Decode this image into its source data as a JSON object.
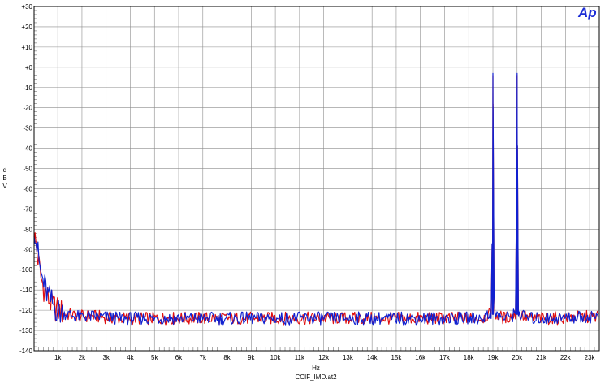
{
  "chart_data": {
    "type": "line",
    "logo": "Ap",
    "xlabel": "Hz",
    "ylabel": "d\nB\nV",
    "filename": "CCIF_IMD.at2",
    "xlim": [
      20,
      23400
    ],
    "ylim": [
      -140,
      30
    ],
    "grid": true,
    "x_ticks": [
      "1k",
      "2k",
      "3k",
      "4k",
      "5k",
      "6k",
      "7k",
      "8k",
      "9k",
      "10k",
      "11k",
      "12k",
      "13k",
      "14k",
      "15k",
      "16k",
      "17k",
      "18k",
      "19k",
      "20k",
      "21k",
      "22k",
      "23k"
    ],
    "y_ticks": [
      "+30",
      "+20",
      "+10",
      "+0",
      "-10",
      "-20",
      "-30",
      "-40",
      "-50",
      "-60",
      "-70",
      "-80",
      "-90",
      "-100",
      "-110",
      "-120",
      "-130",
      "-140"
    ],
    "series_colors": [
      "#e01010",
      "#1020d0"
    ],
    "series": [
      {
        "x": [
          20,
          150,
          300,
          450,
          600,
          750,
          900,
          1100,
          1400,
          1800,
          2500,
          3500,
          5000,
          7000,
          9000,
          11000,
          13000,
          15000,
          17000,
          18500,
          18950,
          19000,
          19050,
          19500,
          19950,
          20000,
          20050,
          20500,
          21500,
          23400
        ],
        "y": [
          -82,
          -92,
          -104,
          -110,
          -114,
          -117,
          -119,
          -121,
          -122,
          -123,
          -123,
          -124,
          -124,
          -124,
          -124,
          -124,
          -124,
          -124,
          -124,
          -124,
          -122,
          -4,
          -122,
          -124,
          -122,
          -4,
          -122,
          -124,
          -124,
          -123
        ]
      },
      {
        "x": [
          20,
          150,
          300,
          450,
          600,
          750,
          900,
          1100,
          1400,
          1800,
          2500,
          3500,
          5000,
          7000,
          9000,
          11000,
          13000,
          15000,
          17000,
          18500,
          18950,
          19000,
          19050,
          19500,
          19950,
          20000,
          20050,
          20500,
          21500,
          23400
        ],
        "y": [
          -77,
          -90,
          -102,
          -108,
          -113,
          -116,
          -119,
          -121,
          -122,
          -123,
          -123,
          -124,
          -124,
          -124,
          -124,
          -124,
          -124,
          -124,
          -124,
          -124,
          -122,
          -3,
          -122,
          -124,
          -122,
          -3,
          -122,
          -124,
          -124,
          -123
        ]
      }
    ]
  }
}
